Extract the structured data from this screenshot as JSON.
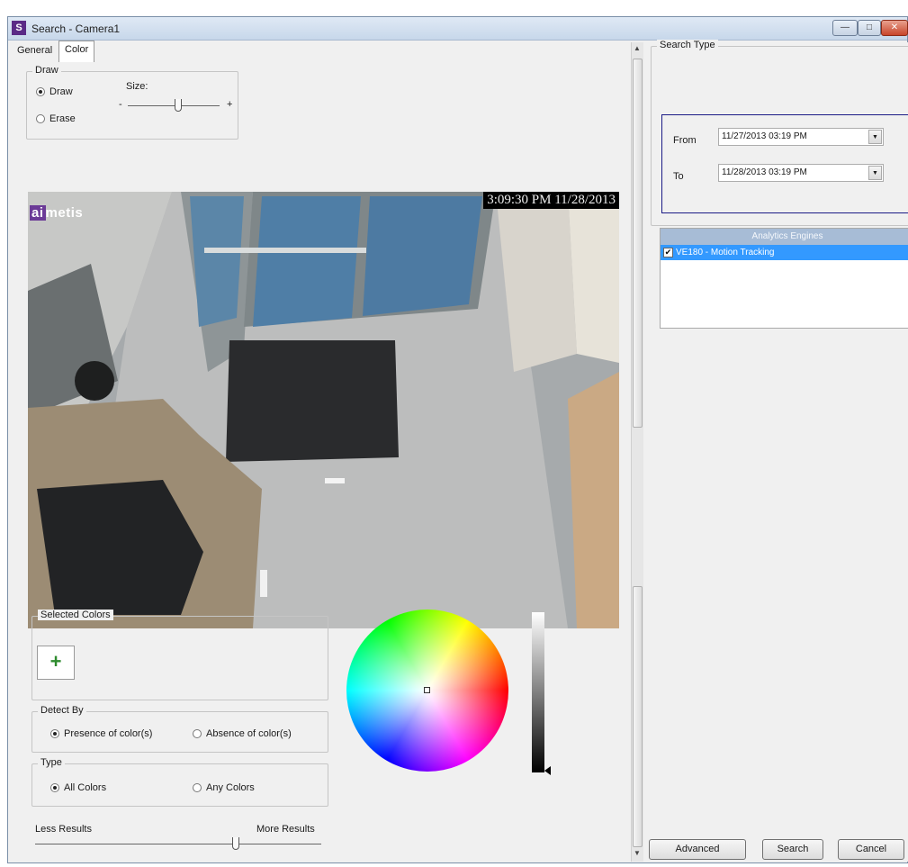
{
  "window": {
    "title": "Search - Camera1",
    "app_icon": "S",
    "controls": {
      "minimize": "minimize-icon",
      "maximize": "maximize-icon",
      "close": "close-icon"
    }
  },
  "tabs": [
    {
      "label": "General",
      "active": false
    },
    {
      "label": "Color",
      "active": true
    }
  ],
  "draw": {
    "group_label": "Draw",
    "option_draw": "Draw",
    "option_erase": "Erase",
    "selected": "Draw",
    "size_label": "Size:",
    "size_minus": "-",
    "size_plus": "+",
    "size_level_fraction": 0.55
  },
  "video": {
    "timestamp": "3:09:30 PM 11/28/2013",
    "logo_first": "ai",
    "logo_rest": "metis"
  },
  "selected_colors": {
    "group_label": "Selected Colors",
    "add_symbol": "+"
  },
  "detect_by": {
    "group_label": "Detect By",
    "option_presence": "Presence of color(s)",
    "option_absence": "Absence of color(s)",
    "selected": "Presence of color(s)"
  },
  "type": {
    "group_label": "Type",
    "option_all": "All Colors",
    "option_any": "Any Colors",
    "selected": "All Colors"
  },
  "results": {
    "less_label": "Less Results",
    "more_label": "More Results",
    "level_fraction": 0.7
  },
  "search_type": {
    "group_label": "Search Type",
    "from_label": "From",
    "from_value": "11/27/2013 03:19 PM",
    "to_label": "To",
    "to_value": "11/28/2013 03:19 PM"
  },
  "analytics": {
    "header": "Analytics Engines",
    "items": [
      {
        "label": "VE180 - Motion Tracking",
        "checked": true,
        "selected": true
      }
    ]
  },
  "buttons": {
    "advanced": "Advanced",
    "search": "Search",
    "cancel": "Cancel"
  },
  "colors": {
    "accent_selection": "#3399ff",
    "dialog_bg": "#f0f0f0",
    "add_plus": "#2e8b2e",
    "brand_purple": "#6b3a96"
  }
}
